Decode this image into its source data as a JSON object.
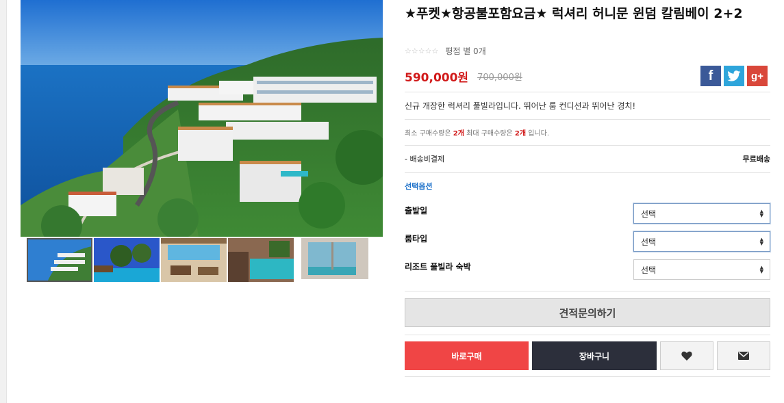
{
  "product": {
    "title": "★푸켓★항공불포함요금★ 럭셔리 허니문 윈덤 칼림베이 2+2",
    "rating_text": "평점 별 0개",
    "price": "590,000원",
    "original_price": "700,000원",
    "description": "신규 개장한 럭셔리 풀빌라입니다. 뛰어난 룸 컨디션과 뛰어난 경치!",
    "qty_prefix": "최소 구매수량은 ",
    "qty_min": "2개",
    "qty_middle": " 최대 구매수량은 ",
    "qty_max": "2개",
    "qty_suffix": " 입니다.",
    "shipping_label": "- 배송비결제",
    "shipping_value": "무료배송"
  },
  "social": {
    "facebook": "f",
    "twitter_icon": "twitter-bird-icon",
    "googleplus": "g+"
  },
  "options": {
    "heading": "선택옵션",
    "items": [
      {
        "label": "출발일",
        "selected": "선택"
      },
      {
        "label": "룸타입",
        "selected": "선택"
      },
      {
        "label": "리조트 풀빌라 숙박",
        "selected": "선택"
      }
    ]
  },
  "actions": {
    "quote": "견적문의하기",
    "buy_now": "바로구매",
    "cart": "장바구니",
    "wishlist_icon": "heart-icon",
    "mail_icon": "envelope-icon"
  },
  "colors": {
    "price_red": "#d11a1a",
    "buy_button": "#f04545",
    "cart_button": "#2c2f3b",
    "option_heading": "#1a6fc9"
  }
}
